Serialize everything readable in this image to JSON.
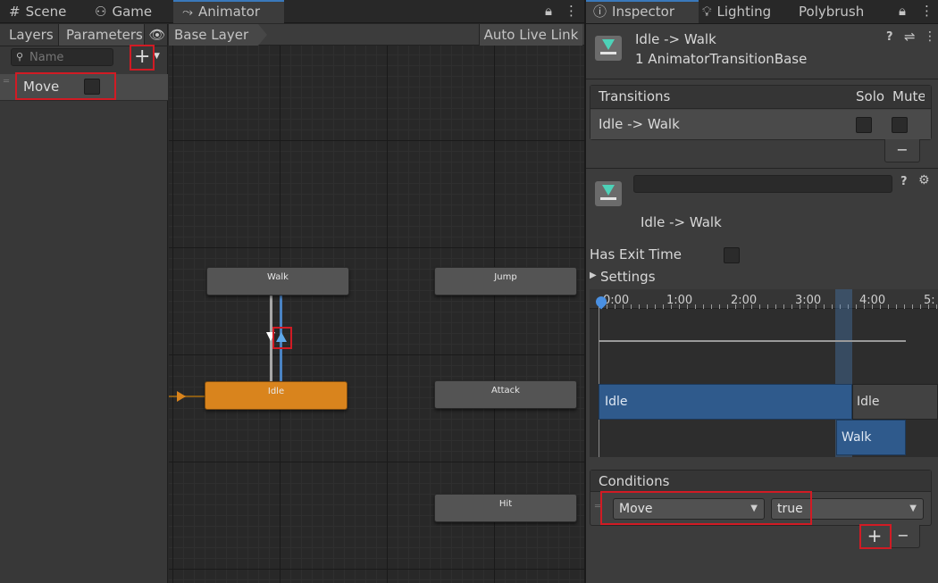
{
  "tabs": {
    "scene": {
      "label": "Scene",
      "icon": "grid-icon"
    },
    "game": {
      "label": "Game",
      "icon": "gamepad-icon"
    },
    "animator": {
      "label": "Animator",
      "icon": "animator-icon"
    }
  },
  "inspector_tabs": {
    "inspector": {
      "label": "Inspector",
      "icon": "info-icon"
    },
    "lighting": {
      "label": "Lighting",
      "icon": "bulb-icon"
    },
    "polybrush": {
      "label": "Polybrush"
    }
  },
  "left_panel": {
    "layers_label": "Layers",
    "parameters_label": "Parameters",
    "search_placeholder": "Name",
    "parameter": {
      "name": "Move",
      "value": false
    }
  },
  "graph": {
    "breadcrumb": "Base Layer",
    "auto_live_link": "Auto Live Link",
    "states": {
      "walk": "Walk",
      "jump": "Jump",
      "idle": "Idle",
      "attack": "Attack",
      "hit": "Hit"
    }
  },
  "inspector": {
    "title": "Idle -> Walk",
    "subtitle": "1 AnimatorTransitionBase",
    "transitions_header": "Transitions",
    "solo_header": "Solo",
    "mute_header": "Mute",
    "transition_row": "Idle -> Walk",
    "remove_symbol": "−",
    "transition_name_value": "",
    "transition_label": "Idle -> Walk",
    "has_exit_time_label": "Has Exit Time",
    "settings_label": "Settings",
    "timeline_ticks": [
      "0:00",
      "1:00",
      "2:00",
      "3:00",
      "4:00",
      "5:"
    ],
    "timeline_source_label": "Idle",
    "timeline_source_label2": "Idle",
    "timeline_dest_label": "Walk",
    "conditions_header": "Conditions",
    "condition_param": "Move",
    "condition_value": "true",
    "add_symbol": "+",
    "minus_symbol": "−"
  },
  "colors": {
    "accent": "#3a79bb",
    "idle_state": "#d9841d",
    "highlight": "#d11b24",
    "timeline_bar": "#2f5a8c"
  }
}
